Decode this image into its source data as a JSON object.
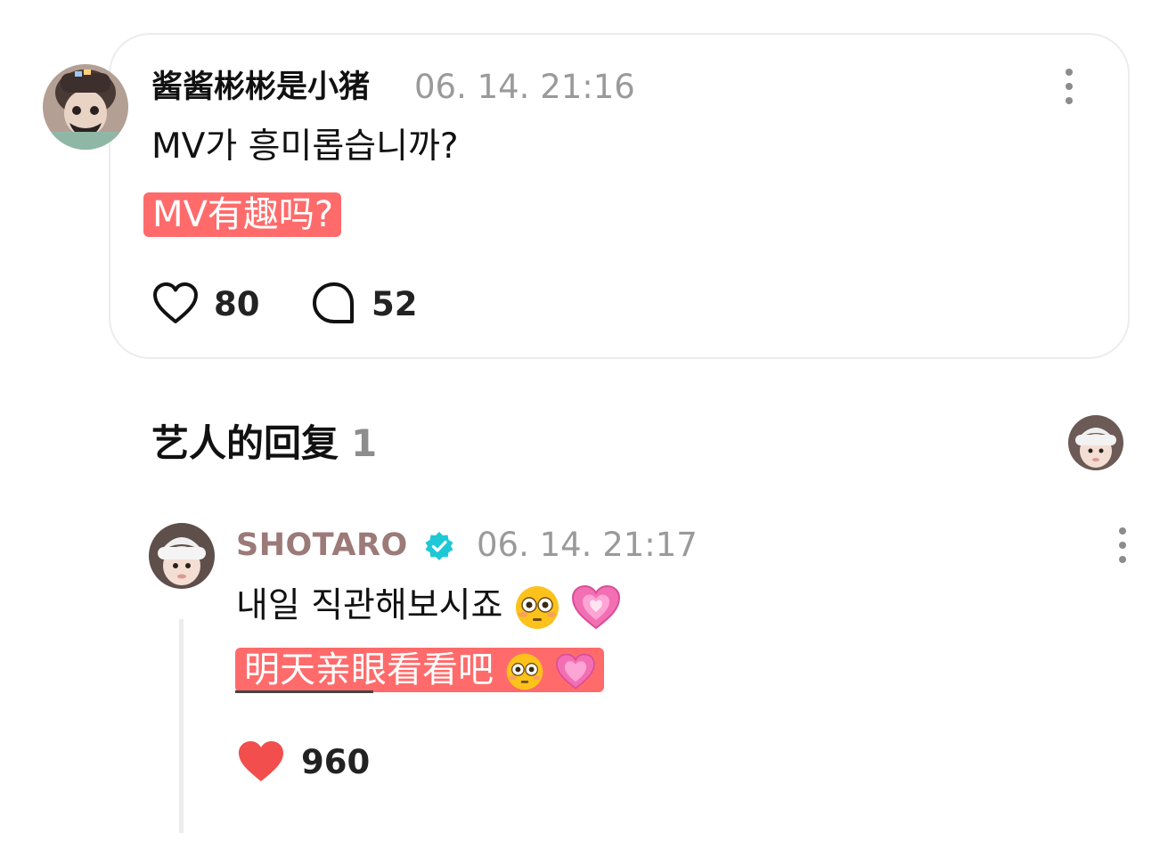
{
  "comment": {
    "username": "酱酱彬彬是小猪",
    "timestamp": "06. 14. 21:16",
    "text": "MV가 흥미롭습니까?",
    "translation": "MV有趣吗?",
    "likes": "80",
    "replies": "52"
  },
  "artist_replies": {
    "title": "艺人的回复",
    "count": "1"
  },
  "reply": {
    "username": "SHOTARO",
    "verified": true,
    "timestamp": "06. 14. 21:17",
    "text": "내일 직관해보시죠",
    "translation": "明天亲眼看看吧",
    "likes": "960"
  },
  "icons": {
    "more": "more-vertical-icon",
    "like": "heart-outline-icon",
    "liked": "heart-filled-icon",
    "comment": "speech-bubble-icon",
    "verified": "verified-badge-icon",
    "emoji_1": "flushed-face",
    "emoji_2": "growing-heart"
  },
  "colors": {
    "translation_highlight": "#ff6b6b",
    "liked_heart": "#f24e4e",
    "verified": "#1ec8d6",
    "artist_name": "#9b7a78",
    "muted": "#9a9a9a"
  }
}
